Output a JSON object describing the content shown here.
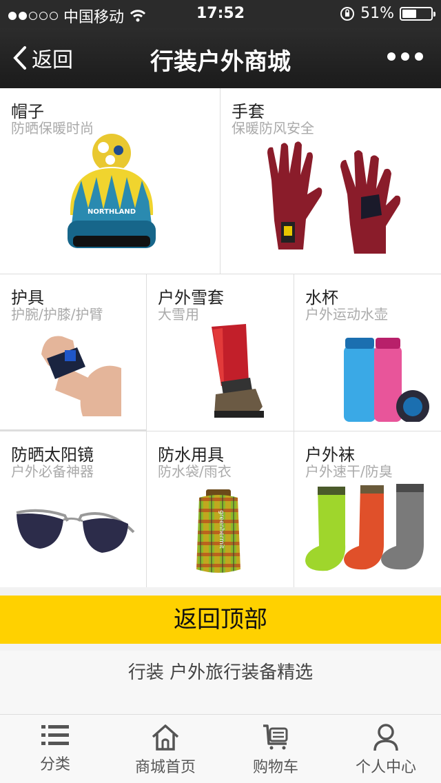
{
  "status_bar": {
    "carrier": "中国移动",
    "time": "17:52",
    "battery": "51%",
    "battery_level": 0.51,
    "signal_bars": 2
  },
  "nav": {
    "back_label": "返回",
    "title": "行装户外商城"
  },
  "categories": [
    {
      "name": "帽子",
      "subtitle": "防晒保暖时尚"
    },
    {
      "name": "手套",
      "subtitle": "保暖防风安全"
    },
    {
      "name": "护具",
      "subtitle": "护腕/护膝/护臂"
    },
    {
      "name": "户外雪套",
      "subtitle": "大雪用"
    },
    {
      "name": "水杯",
      "subtitle": "户外运动水壶"
    },
    {
      "name": "防晒太阳镜",
      "subtitle": "户外必备神器"
    },
    {
      "name": "防水用具",
      "subtitle": "防水袋/雨衣"
    },
    {
      "name": "户外袜",
      "subtitle": "户外速干/防臭"
    }
  ],
  "hat_brand": "NORTHLAND",
  "bag_brand": "greenhermit",
  "back_to_top": "返回顶部",
  "tagline": "行装 户外旅行装备精选",
  "tabs": [
    {
      "label": "分类",
      "icon": "list-icon"
    },
    {
      "label": "商城首页",
      "icon": "home-icon"
    },
    {
      "label": "购物车",
      "icon": "cart-icon"
    },
    {
      "label": "个人中心",
      "icon": "user-icon"
    }
  ]
}
